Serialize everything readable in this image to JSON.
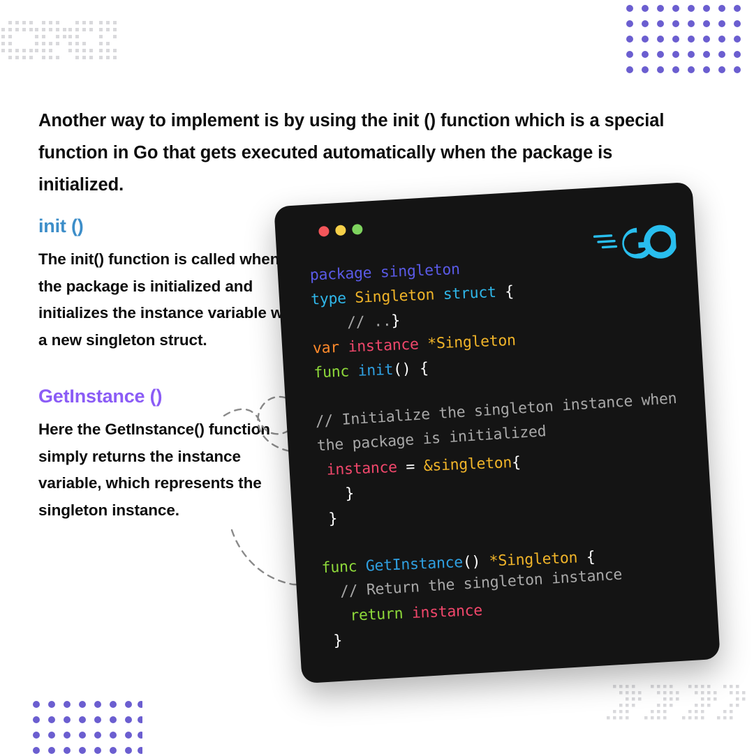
{
  "slide": {
    "intro_paragraph": "Another way to implement is by using the init () function which is a special function in Go that gets executed automatically when the package is initialized."
  },
  "sections": [
    {
      "id": "init",
      "heading": "init ()",
      "heading_color": "#3d8ec9",
      "body": "The init() function is called when the package is initialized and initializes the instance variable with a new singleton struct."
    },
    {
      "id": "getinstance",
      "heading": "GetInstance ()",
      "heading_color": "#8b5cf6",
      "body": "Here the GetInstance() function simply returns the instance variable, which represents the singleton instance."
    }
  ],
  "code_window": {
    "background": "#141414",
    "logo_label": "GO",
    "logo_color": "#29beee",
    "traffic_lights": [
      {
        "name": "close",
        "color": "#f4565a"
      },
      {
        "name": "minimize",
        "color": "#f6d049"
      },
      {
        "name": "maximize",
        "color": "#7ed35e"
      }
    ],
    "language": "go",
    "code_lines": [
      {
        "tokens": [
          {
            "t": "package",
            "c": "keyword"
          },
          {
            "t": " ",
            "c": "plain"
          },
          {
            "t": "singleton",
            "c": "package"
          }
        ]
      },
      {
        "tokens": [
          {
            "t": "type",
            "c": "type"
          },
          {
            "t": " ",
            "c": "plain"
          },
          {
            "t": "Singleton",
            "c": "typename"
          },
          {
            "t": " ",
            "c": "plain"
          },
          {
            "t": "struct",
            "c": "type"
          },
          {
            "t": " ",
            "c": "plain"
          },
          {
            "t": "{",
            "c": "punct"
          }
        ]
      },
      {
        "tokens": [
          {
            "t": "    ",
            "c": "plain"
          },
          {
            "t": "// ..",
            "c": "comment"
          },
          {
            "t": "}",
            "c": "punct"
          }
        ]
      },
      {
        "tokens": [
          {
            "t": "var",
            "c": "var"
          },
          {
            "t": " ",
            "c": "plain"
          },
          {
            "t": "instance",
            "c": "ident"
          },
          {
            "t": " ",
            "c": "plain"
          },
          {
            "t": "*Singleton",
            "c": "typename"
          }
        ]
      },
      {
        "tokens": [
          {
            "t": "func",
            "c": "func"
          },
          {
            "t": " ",
            "c": "plain"
          },
          {
            "t": "init",
            "c": "fname"
          },
          {
            "t": "() {",
            "c": "punct"
          }
        ]
      },
      {
        "tokens": [
          {
            "t": "   // Initialize the singleton instance when the package is initialized",
            "c": "comment"
          }
        ]
      },
      {
        "tokens": [
          {
            "t": " ",
            "c": "plain"
          },
          {
            "t": "instance",
            "c": "ident"
          },
          {
            "t": " = ",
            "c": "punct"
          },
          {
            "t": "&singleton",
            "c": "amp"
          },
          {
            "t": "{",
            "c": "punct"
          }
        ]
      },
      {
        "tokens": [
          {
            "t": "   }",
            "c": "punct"
          }
        ]
      },
      {
        "tokens": [
          {
            "t": " }",
            "c": "punct"
          }
        ]
      },
      {
        "tokens": []
      },
      {
        "tokens": [
          {
            "t": "func",
            "c": "func"
          },
          {
            "t": " ",
            "c": "plain"
          },
          {
            "t": "GetInstance",
            "c": "fname"
          },
          {
            "t": "()",
            "c": "punct"
          },
          {
            "t": " ",
            "c": "plain"
          },
          {
            "t": "*Singleton",
            "c": "typename"
          },
          {
            "t": " {",
            "c": "punct"
          }
        ]
      },
      {
        "tokens": [
          {
            "t": "  // Return the singleton instance",
            "c": "comment"
          }
        ]
      },
      {
        "tokens": [
          {
            "t": "   ",
            "c": "plain"
          },
          {
            "t": "return",
            "c": "func"
          },
          {
            "t": " ",
            "c": "plain"
          },
          {
            "t": "instance",
            "c": "ident"
          }
        ]
      },
      {
        "tokens": [
          {
            "t": " }",
            "c": "punct"
          }
        ]
      }
    ],
    "plain_code": "package singleton\ntype Singleton struct {\n    // ..}\nvar instance *Singleton\nfunc init() {\n   // Initialize the singleton instance when the package is initialized\n instance = &singleton{\n   }\n }\n\nfunc GetInstance() *Singleton {\n  // Return the singleton instance\n   return instance\n }"
  },
  "decorations": {
    "dot_grid_purple_color": "#6b5ed0",
    "dot_pattern_gray_color": "#d6d6d8",
    "arrow_color": "#8a8a8a",
    "arrows": [
      {
        "name": "arrow-init",
        "style": "dashed-loop"
      },
      {
        "name": "arrow-getinstance",
        "style": "dashed-curve"
      }
    ]
  }
}
